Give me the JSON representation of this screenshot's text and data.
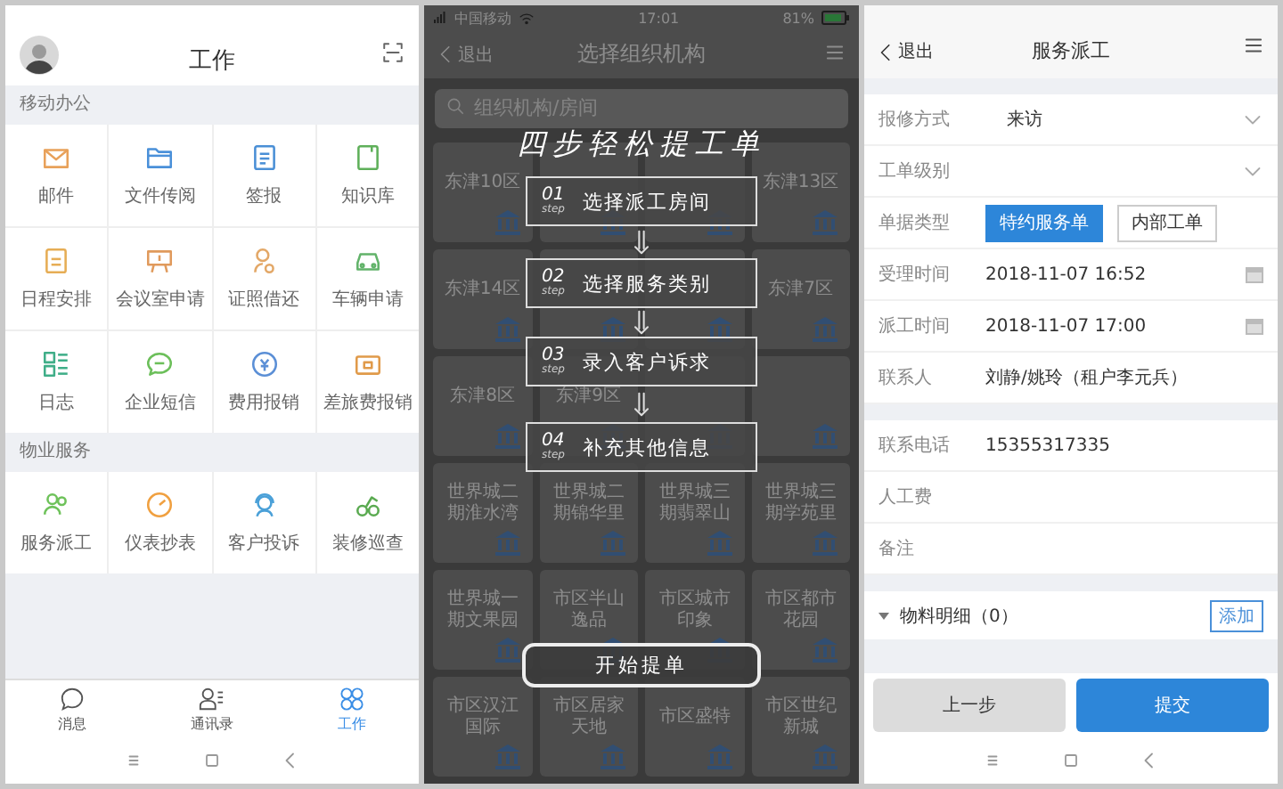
{
  "work_screen": {
    "title": "工作",
    "sections": [
      {
        "title": "移动办公",
        "items": [
          {
            "label": "邮件",
            "color": "#e8a15a"
          },
          {
            "label": "文件传阅",
            "color": "#4a90d9"
          },
          {
            "label": "签报",
            "color": "#4a8fd6"
          },
          {
            "label": "知识库",
            "color": "#5fb05a"
          },
          {
            "label": "日程安排",
            "color": "#e6ad55"
          },
          {
            "label": "会议室申请",
            "color": "#e09a5c"
          },
          {
            "label": "证照借还",
            "color": "#e3a868"
          },
          {
            "label": "车辆申请",
            "color": "#62b36a"
          },
          {
            "label": "日志",
            "color": "#3fae88"
          },
          {
            "label": "企业短信",
            "color": "#6cbf5a"
          },
          {
            "label": "费用报销",
            "color": "#5b8fd6"
          },
          {
            "label": "差旅费报销",
            "color": "#e09a4a"
          }
        ]
      },
      {
        "title": "物业服务",
        "items": [
          {
            "label": "服务派工",
            "color": "#6ec25a"
          },
          {
            "label": "仪表抄表",
            "color": "#f0a040"
          },
          {
            "label": "客户投诉",
            "color": "#4aa0d8"
          },
          {
            "label": "装修巡查",
            "color": "#5aaa50"
          }
        ]
      }
    ],
    "tabs": [
      {
        "label": "消息",
        "selected": false
      },
      {
        "label": "通讯录",
        "selected": false
      },
      {
        "label": "工作",
        "selected": true
      }
    ]
  },
  "org_screen": {
    "status_bar": {
      "carrier": "中国移动",
      "time": "17:01",
      "battery": "81%"
    },
    "back": "退出",
    "title": "选择组织机构",
    "search": {
      "placeholder": "组织机构/房间"
    },
    "cards": [
      {
        "kind": "named",
        "name": "东津10区"
      },
      {
        "kind": "covered"
      },
      {
        "kind": "covered"
      },
      {
        "kind": "named",
        "name": "东津13区"
      },
      {
        "kind": "named",
        "name": "东津14区"
      },
      {
        "kind": "covered"
      },
      {
        "kind": "covered"
      },
      {
        "kind": "named",
        "name": "东津7区"
      },
      {
        "kind": "named",
        "name": "东津8区"
      },
      {
        "kind": "named",
        "name": "东津9区"
      },
      {
        "kind": "covered"
      },
      {
        "kind": "covered"
      },
      {
        "kind": "named",
        "name": "世界城二期淮水湾"
      },
      {
        "kind": "named",
        "name": "世界城二期锦华里"
      },
      {
        "kind": "named",
        "name": "世界城三期翡翠山"
      },
      {
        "kind": "named",
        "name": "世界城三期学苑里"
      },
      {
        "kind": "named",
        "name": "世界城一期文果园"
      },
      {
        "kind": "named",
        "name": "市区半山逸品"
      },
      {
        "kind": "named",
        "name": "市区城市印象"
      },
      {
        "kind": "named",
        "name": "市区都市花园"
      },
      {
        "kind": "named",
        "name": "市区汉江国际"
      },
      {
        "kind": "named",
        "name": "市区居家天地"
      },
      {
        "kind": "named",
        "name": "市区盛特"
      },
      {
        "kind": "named",
        "name": "市区世纪新城"
      }
    ],
    "guide": {
      "title": "四步轻松提工单",
      "steps": [
        {
          "number": "01",
          "step": "step",
          "text": "选择派工房间"
        },
        {
          "number": "02",
          "step": "step",
          "text": "选择服务类别"
        },
        {
          "number": "03",
          "step": "step",
          "text": "录入客户诉求"
        },
        {
          "number": "04",
          "step": "step",
          "text": "补充其他信息"
        }
      ],
      "button": "开始提单"
    }
  },
  "dispatch_screen": {
    "back": "退出",
    "title": "服务派工",
    "groups": [
      [
        {
          "kind": "select",
          "label": "报修方式",
          "value": "来访"
        },
        {
          "kind": "select",
          "label": "工单级别"
        },
        {
          "kind": "toggle",
          "label": "单据类型",
          "options": [
            {
              "label": "特约服务单",
              "selected": true
            },
            {
              "label": "内部工单",
              "selected": false
            }
          ]
        },
        {
          "kind": "datetime",
          "label": "受理时间",
          "value": "2018-11-07 16:52"
        },
        {
          "kind": "datetime",
          "label": "派工时间",
          "value": "2018-11-07 17:00"
        },
        {
          "kind": "text",
          "label": "联系人",
          "value": "刘静/姚玲（租户李元兵）"
        }
      ],
      [
        {
          "kind": "text",
          "label": "联系电话",
          "value": "15355317335"
        },
        {
          "kind": "text",
          "label": "人工费"
        },
        {
          "kind": "text",
          "label": "备注"
        }
      ]
    ],
    "materials": {
      "title": "物料明细（0）",
      "expanded": true,
      "add": "添加"
    },
    "buttons": {
      "back": "上一步",
      "submit": "提交"
    }
  }
}
